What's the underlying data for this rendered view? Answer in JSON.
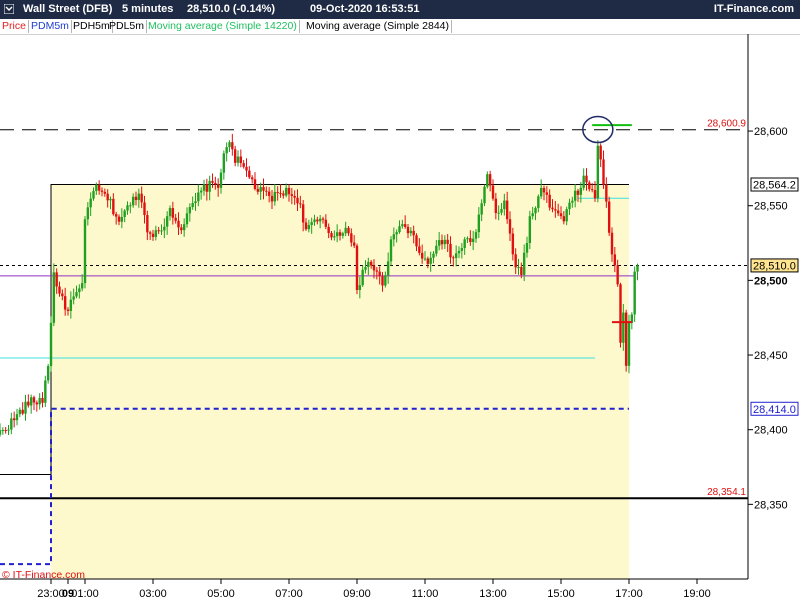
{
  "header": {
    "instrument": "Wall Street (DFB)",
    "timeframe": "5 minutes",
    "quote": "28,510.0 (-0.14%)",
    "datetime": "09-Oct-2020 16:53:51",
    "brand": "IT-Finance.com"
  },
  "legend": [
    {
      "label": "Price",
      "color": "#e02020"
    },
    {
      "label": "PDM5m",
      "color": "#2040d0"
    },
    {
      "label": "PDH5m",
      "color": "#000000"
    },
    {
      "label": "PDL5m",
      "color": "#000000"
    },
    {
      "label": "Moving average (Simple 14220)",
      "color": "#20c060"
    },
    {
      "label": "Moving average (Simple 2844)",
      "color": "#000000"
    }
  ],
  "watermark": "© IT-Finance.com",
  "colors": {
    "up": "#20a020",
    "down": "#e01010",
    "shade": "#fdf9cc",
    "current_price_tag": "#ffe590",
    "purple_ma": "#9030c0",
    "cyan_line": "#40e0e0",
    "blue_level": "#2020d0"
  },
  "chart_data": {
    "type": "candlestick",
    "ylim": [
      28300,
      28665
    ],
    "y_ticks": [
      28350,
      28400,
      28450,
      28500,
      28550,
      28600
    ],
    "y_tick_labels": [
      "28,350",
      "28,400",
      "28,450",
      "28,500",
      "28,550",
      "28,600"
    ],
    "x_ticks": [
      {
        "label": "23:00",
        "t": 0
      },
      {
        "label": "09",
        "t": 6,
        "bold": true
      },
      {
        "label": "01:00",
        "t": 12
      },
      {
        "label": "03:00",
        "t": 36
      },
      {
        "label": "05:00",
        "t": 60
      },
      {
        "label": "07:00",
        "t": 84
      },
      {
        "label": "09:00",
        "t": 108
      },
      {
        "label": "11:00",
        "t": 132
      },
      {
        "label": "13:00",
        "t": 156
      },
      {
        "label": "15:00",
        "t": 180
      },
      {
        "label": "17:00",
        "t": 204
      },
      {
        "label": "19:00",
        "t": 228
      }
    ],
    "price_labels": [
      {
        "value": 28600.9,
        "text": "28,600.9",
        "style": "level"
      },
      {
        "value": 28564.2,
        "text": "28,564.2",
        "style": "box"
      },
      {
        "value": 28510.0,
        "text": "28,510.0",
        "style": "current"
      },
      {
        "value": 28500,
        "text": "28,500",
        "style": "bold-tick"
      },
      {
        "value": 28414.0,
        "text": "28,414.0",
        "style": "box-blue"
      },
      {
        "value": 28354.1,
        "text": "28,354.1",
        "style": "level"
      }
    ],
    "levels": {
      "previous_day_high": 28600.9,
      "previous_day_low": 28354.1,
      "current_price": 28510.0,
      "pdh5m_steps": [
        {
          "t_from": -18,
          "t_to": 0,
          "value": 28370
        },
        {
          "t_from": 0,
          "t_to": 204,
          "value": 28564.2
        }
      ],
      "pdm5m_steps": [
        {
          "t_from": -18,
          "t_to": 0,
          "value": 28310
        },
        {
          "t_from": 0,
          "t_to": 204,
          "value": 28414.0
        }
      ],
      "ma_simple_2844": 28503,
      "ma_simple_14220": {
        "value": 28448,
        "t_to": 192
      },
      "cyan_short": {
        "value": 28555,
        "t_from": 186,
        "t_to": 204
      },
      "green_short": {
        "value": 28604,
        "t_from": 191,
        "t_to": 205
      },
      "red_short": {
        "value": 28472,
        "t_from": 198,
        "t_to": 205
      }
    },
    "t_range": [
      -18,
      246
    ],
    "shaded_region": {
      "t_from": 0,
      "t_to": 204,
      "value_from": 28300,
      "value_to": 28564.2
    },
    "circle_marker": {
      "t": 193,
      "value": 28601
    },
    "anchors": [
      [
        -18,
        28398
      ],
      [
        -14,
        28405
      ],
      [
        -8,
        28418
      ],
      [
        -3,
        28420
      ],
      [
        -1,
        28445
      ],
      [
        0,
        28470
      ],
      [
        1,
        28505
      ],
      [
        3,
        28492
      ],
      [
        5,
        28480
      ],
      [
        8,
        28488
      ],
      [
        11,
        28495
      ],
      [
        12,
        28540
      ],
      [
        15,
        28562
      ],
      [
        20,
        28555
      ],
      [
        24,
        28540
      ],
      [
        27,
        28548
      ],
      [
        31,
        28560
      ],
      [
        34,
        28535
      ],
      [
        38,
        28530
      ],
      [
        42,
        28548
      ],
      [
        46,
        28535
      ],
      [
        50,
        28550
      ],
      [
        54,
        28562
      ],
      [
        59,
        28565
      ],
      [
        62,
        28590
      ],
      [
        63,
        28594
      ],
      [
        65,
        28582
      ],
      [
        70,
        28570
      ],
      [
        73,
        28560
      ],
      [
        78,
        28555
      ],
      [
        82,
        28560
      ],
      [
        87,
        28555
      ],
      [
        90,
        28535
      ],
      [
        95,
        28540
      ],
      [
        99,
        28530
      ],
      [
        104,
        28535
      ],
      [
        107,
        28520
      ],
      [
        108,
        28495
      ],
      [
        112,
        28515
      ],
      [
        116,
        28500
      ],
      [
        118,
        28500
      ],
      [
        120,
        28525
      ],
      [
        124,
        28540
      ],
      [
        129,
        28525
      ],
      [
        133,
        28510
      ],
      [
        137,
        28530
      ],
      [
        142,
        28515
      ],
      [
        146,
        28525
      ],
      [
        150,
        28530
      ],
      [
        151,
        28545
      ],
      [
        154,
        28570
      ],
      [
        157,
        28545
      ],
      [
        160,
        28550
      ],
      [
        164,
        28510
      ],
      [
        166,
        28505
      ],
      [
        169,
        28540
      ],
      [
        173,
        28560
      ],
      [
        178,
        28545
      ],
      [
        181,
        28540
      ],
      [
        183,
        28550
      ],
      [
        186,
        28560
      ],
      [
        188,
        28568
      ],
      [
        192,
        28555
      ],
      [
        193,
        28590
      ],
      [
        194,
        28582
      ],
      [
        196,
        28550
      ],
      [
        198,
        28515
      ],
      [
        200,
        28500
      ],
      [
        201,
        28460
      ],
      [
        202,
        28475
      ],
      [
        203,
        28445
      ],
      [
        204,
        28470
      ],
      [
        205,
        28480
      ],
      [
        206,
        28505
      ],
      [
        207,
        28510
      ]
    ]
  }
}
